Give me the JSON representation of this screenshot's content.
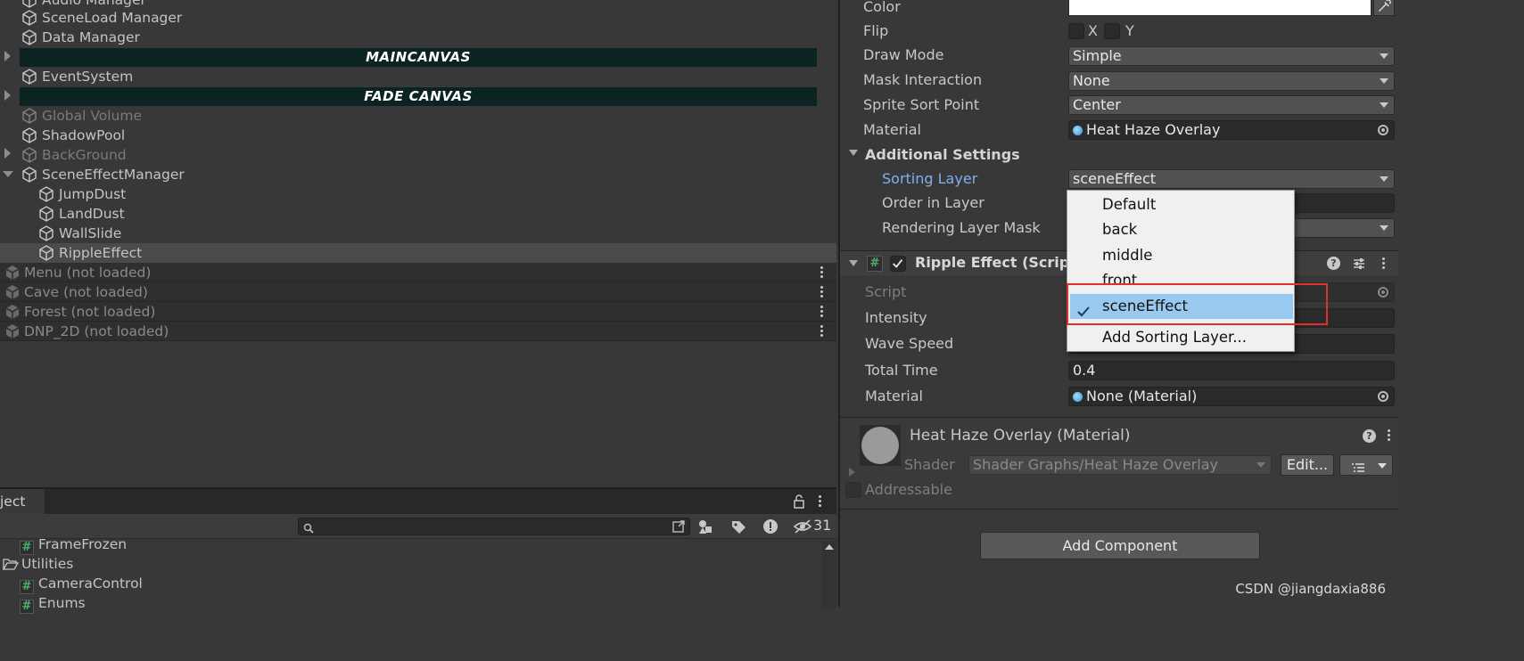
{
  "hierarchy": {
    "items": [
      {
        "label": "Audio Manager"
      },
      {
        "label": "SceneLoad Manager"
      },
      {
        "label": "Data Manager"
      },
      {
        "label": "MAINCANVAS"
      },
      {
        "label": "EventSystem"
      },
      {
        "label": "FADE CANVAS"
      },
      {
        "label": "Global Volume"
      },
      {
        "label": "ShadowPool"
      },
      {
        "label": "BackGround"
      },
      {
        "label": "SceneEffectManager"
      },
      {
        "label": "JumpDust"
      },
      {
        "label": "LandDust"
      },
      {
        "label": "WallSlide"
      },
      {
        "label": "RippleEffect"
      }
    ],
    "scenes": [
      {
        "label": "Menu (not loaded)"
      },
      {
        "label": "Cave (not loaded)"
      },
      {
        "label": "Forest (not loaded)"
      },
      {
        "label": "DNP_2D (not loaded)"
      }
    ]
  },
  "project": {
    "tab_label": "ject",
    "search": {
      "value": "",
      "placeholder": ""
    },
    "hidden_count": "31",
    "rows": [
      {
        "label": "FrameFrozen",
        "icon": "script-icon"
      },
      {
        "label": "Utilities",
        "icon": "folder-open-icon"
      },
      {
        "label": "CameraControl",
        "icon": "script-icon"
      },
      {
        "label": "Enums",
        "icon": "script-icon"
      }
    ]
  },
  "inspector": {
    "color_label": "Color",
    "flip_label": "Flip",
    "flip_x": "X",
    "flip_y": "Y",
    "draw_mode_label": "Draw Mode",
    "draw_mode_value": "Simple",
    "mask_interaction_label": "Mask Interaction",
    "mask_interaction_value": "None",
    "sprite_sort_point_label": "Sprite Sort Point",
    "sprite_sort_point_value": "Center",
    "material_label": "Material",
    "material_value": "Heat Haze Overlay",
    "additional_settings_label": "Additional Settings",
    "sorting_layer_label": "Sorting Layer",
    "sorting_layer_value": "sceneEffect",
    "order_in_layer_label": "Order in Layer",
    "rendering_layer_mask_label": "Rendering Layer Mask",
    "ripple": {
      "title": "Ripple Effect (Script",
      "script_label": "Script",
      "intensity_label": "Intensity",
      "wave_speed_label": "Wave Speed",
      "total_time_label": "Total Time",
      "total_time_value": "0.4",
      "material_label": "Material",
      "material_value": "None (Material)"
    },
    "material_component": {
      "title": "Heat Haze Overlay (Material)",
      "shader_label": "Shader",
      "shader_value": "Shader Graphs/Heat Haze Overlay",
      "edit_label": "Edit...",
      "addressable_label": "Addressable"
    },
    "add_component_label": "Add Component"
  },
  "dropdown": {
    "options": [
      "Default",
      "back",
      "middle",
      "front",
      "sceneEffect"
    ],
    "selected": "sceneEffect",
    "add_label": "Add Sorting Layer..."
  },
  "watermark": "CSDN @jiangdaxia886",
  "colors": {
    "canvas_bar": "#0b2321",
    "selection_blue": "#99c9ef",
    "highlight_red": "#e0312f",
    "sorting_layer_label": "#7fb0f0"
  }
}
